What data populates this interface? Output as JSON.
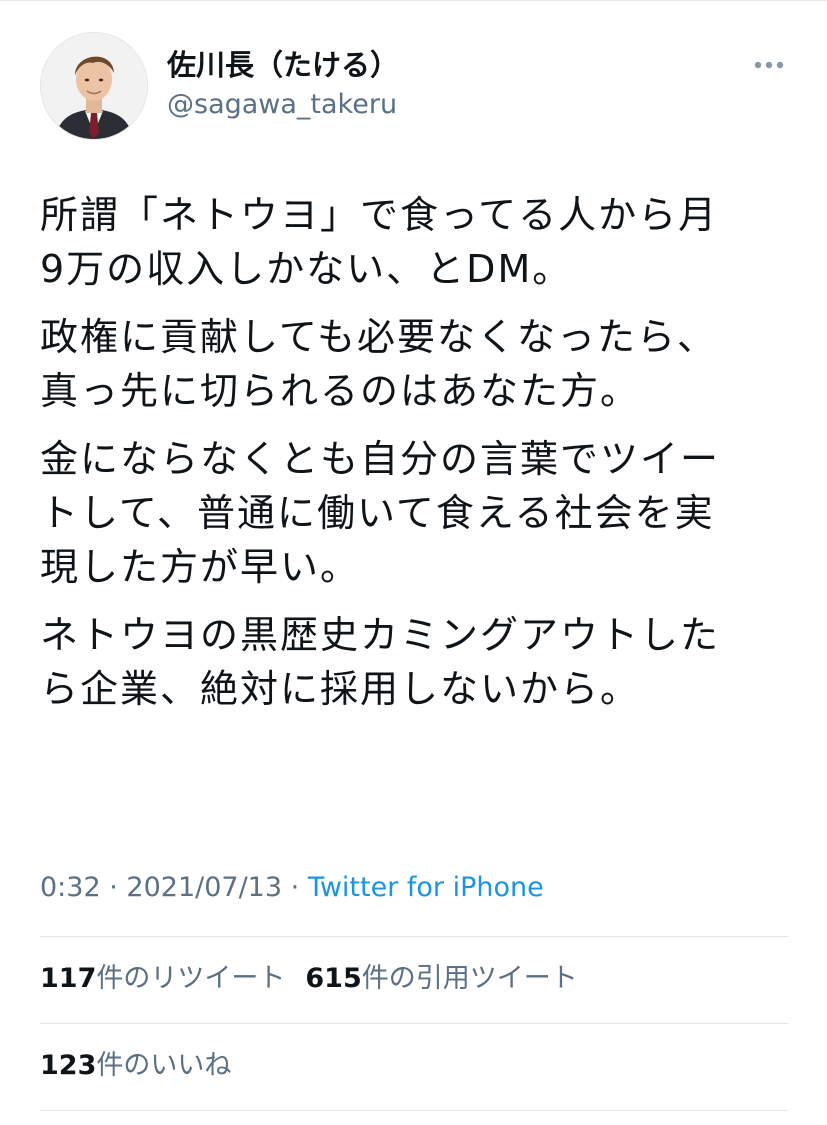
{
  "user": {
    "display_name": "佐川長（たける）",
    "handle": "@sagawa_takeru",
    "avatar_icon": "profile-photo-avatar"
  },
  "menu": {
    "more_icon": "more-horizontal-icon"
  },
  "tweet": {
    "paragraphs": [
      {
        "lines": [
          "所謂「ネトウヨ」で食ってる人から月",
          "9万の収入しかない、とDM。"
        ]
      },
      {
        "lines": [
          "政権に貢献しても必要なくなったら、",
          "真っ先に切られるのはあなた方。"
        ]
      },
      {
        "lines": [
          "金にならなくとも自分の言葉でツイー",
          "トして、普通に働いて食える社会を実",
          "現した方が早い。"
        ]
      },
      {
        "lines": [
          "ネトウヨの黒歴史カミングアウトした",
          "ら企業、絶対に採用しないから。"
        ]
      }
    ]
  },
  "meta": {
    "time": "0:32",
    "separator": "·",
    "date": "2021/07/13",
    "source": "Twitter for iPhone"
  },
  "stats": {
    "retweets_count": "117",
    "retweets_label": "件のリツイート",
    "quotes_count": "615",
    "quotes_label": "件の引用ツイート",
    "likes_count": "123",
    "likes_label": "件のいいね"
  },
  "colors": {
    "text_primary": "#0f1419",
    "text_secondary": "#5b7083",
    "link": "#1b95e0",
    "divider": "#e1e6ea"
  }
}
